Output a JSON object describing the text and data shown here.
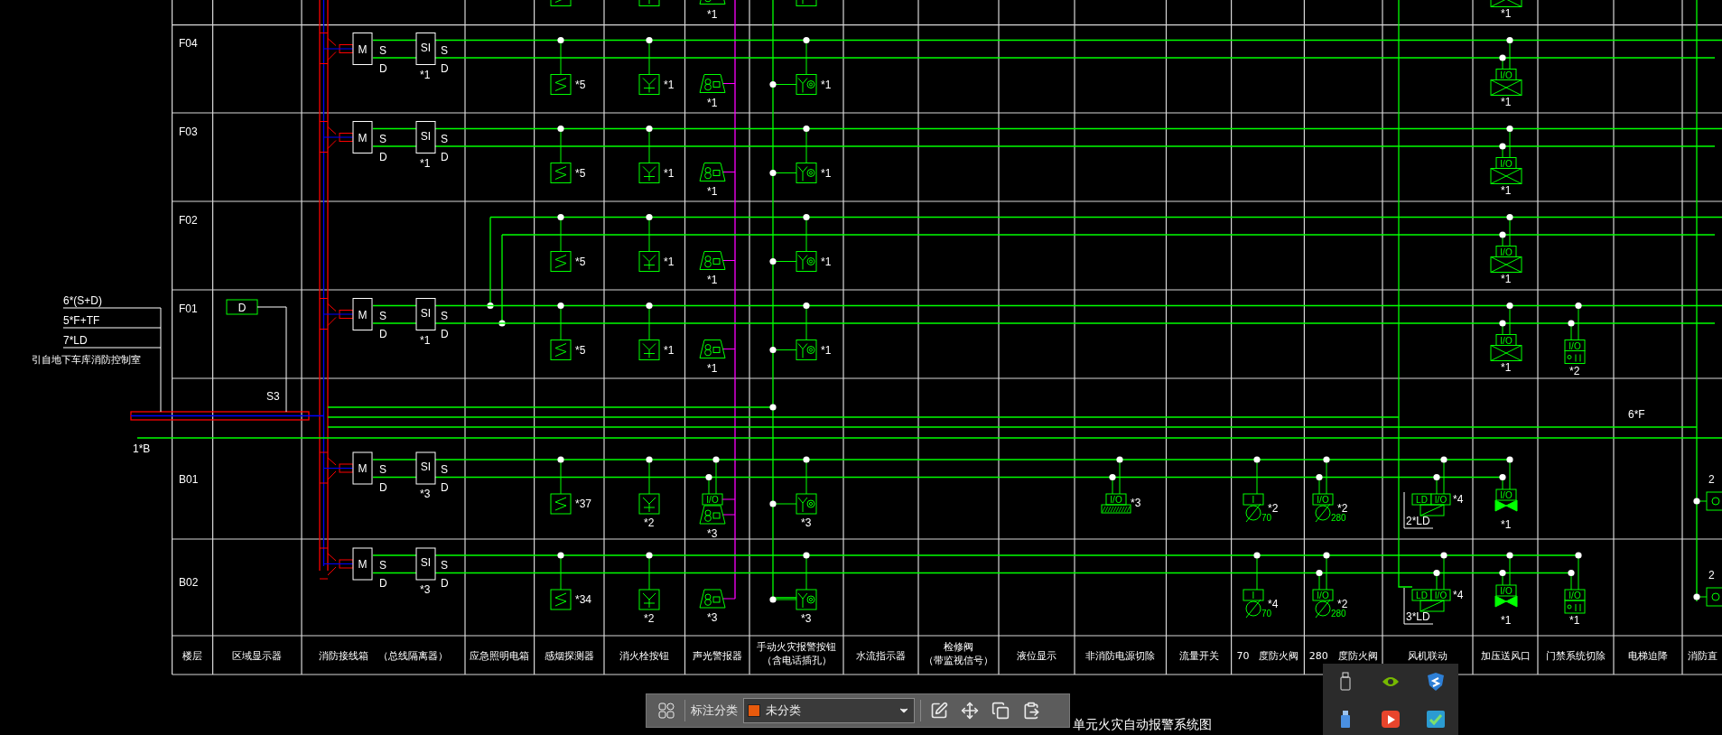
{
  "header": [
    {
      "lines": [
        "楼层"
      ]
    },
    {
      "lines": [
        "区域显示器"
      ]
    },
    {
      "lines": [
        "消防接线箱　（总线隔离器）"
      ]
    },
    {
      "lines": [
        "应急照明电箱"
      ]
    },
    {
      "lines": [
        "感烟探测器"
      ]
    },
    {
      "lines": [
        "消火栓按钮"
      ]
    },
    {
      "lines": [
        "声光警报器"
      ]
    },
    {
      "lines": [
        "手动火灾报警按钮",
        "（含电话插孔）"
      ]
    },
    {
      "lines": [
        "水流指示器"
      ]
    },
    {
      "lines": [
        "检修阀",
        "（带监视信号）"
      ]
    },
    {
      "lines": [
        "液位显示"
      ]
    },
    {
      "lines": [
        "非消防电源切除"
      ]
    },
    {
      "lines": [
        "流量开关"
      ]
    },
    {
      "lines": [
        "70　度防火阀"
      ]
    },
    {
      "lines": [
        "280　度防火阀"
      ]
    },
    {
      "lines": [
        "风机联动"
      ]
    },
    {
      "lines": [
        "加压送风口"
      ]
    },
    {
      "lines": [
        "门禁系统切除"
      ]
    },
    {
      "lines": [
        "电梯迫降"
      ]
    },
    {
      "lines": [
        "消防直"
      ]
    }
  ],
  "feed": {
    "cables": [
      "6*(S+D)",
      "5*F+TF",
      "7*LD"
    ],
    "source": "引自地下车库消防控制室",
    "bus": "1*B"
  },
  "area_display": {
    "symbol": "D",
    "line_label": "S3"
  },
  "fan_bus_label": "6*F",
  "floors": [
    {
      "devices": [
        {
          "kind": "smoke"
        },
        {
          "kind": "hydrant"
        },
        {
          "kind": "alarm",
          "count": "*1"
        },
        {
          "kind": "manual"
        },
        {
          "kind": "vent",
          "count": "*1"
        }
      ]
    },
    {
      "label": "F04",
      "junction": {
        "module": "M",
        "module_in": "S",
        "module_out": "D",
        "isolator": "SI",
        "isolator_in": "S",
        "isolator_out": "D",
        "count": "*1"
      },
      "devices": [
        {
          "kind": "smoke",
          "count": "*5"
        },
        {
          "kind": "hydrant",
          "count": "*1"
        },
        {
          "kind": "alarm",
          "count": "*1"
        },
        {
          "kind": "manual",
          "count": "*1"
        },
        {
          "kind": "vent",
          "io": "I/O",
          "count": "*1"
        }
      ]
    },
    {
      "label": "F03",
      "junction": {
        "module": "M",
        "module_in": "S",
        "module_out": "D",
        "isolator": "SI",
        "isolator_in": "S",
        "isolator_out": "D",
        "count": "*1"
      },
      "devices": [
        {
          "kind": "smoke",
          "count": "*5"
        },
        {
          "kind": "hydrant",
          "count": "*1"
        },
        {
          "kind": "alarm",
          "count": "*1"
        },
        {
          "kind": "manual",
          "count": "*1"
        },
        {
          "kind": "vent",
          "io": "I/O",
          "count": "*1"
        }
      ]
    },
    {
      "label": "F02",
      "devices": [
        {
          "kind": "smoke",
          "count": "*5"
        },
        {
          "kind": "hydrant",
          "count": "*1"
        },
        {
          "kind": "alarm",
          "count": "*1"
        },
        {
          "kind": "manual",
          "count": "*1"
        },
        {
          "kind": "vent",
          "io": "I/O",
          "count": "*1"
        }
      ]
    },
    {
      "label": "F01",
      "junction": {
        "module": "M",
        "module_in": "S",
        "module_out": "D",
        "isolator": "SI",
        "isolator_in": "S",
        "isolator_out": "D",
        "count": "*1"
      },
      "devices": [
        {
          "kind": "smoke",
          "count": "*5"
        },
        {
          "kind": "hydrant",
          "count": "*1"
        },
        {
          "kind": "alarm",
          "count": "*1"
        },
        {
          "kind": "manual",
          "count": "*1"
        },
        {
          "kind": "vent",
          "io": "I/O",
          "count": "*1"
        },
        {
          "kind": "door",
          "io": "I/O",
          "count": "*2"
        }
      ]
    },
    {
      "label": "B01",
      "junction": {
        "module": "M",
        "module_in": "S",
        "module_out": "D",
        "isolator": "SI",
        "isolator_in": "S",
        "isolator_out": "D",
        "count": "*3"
      },
      "devices": [
        {
          "kind": "smoke",
          "count": "*37"
        },
        {
          "kind": "hydrant",
          "count": "*2"
        },
        {
          "kind": "alarm",
          "io": "I/O",
          "count": "*3"
        },
        {
          "kind": "manual",
          "count": "*3"
        },
        {
          "kind": "cutoff",
          "io": "I/O",
          "count": "*3"
        },
        {
          "kind": "damper70",
          "input": "I",
          "size": "70",
          "count": "*2"
        },
        {
          "kind": "damper280",
          "io": "I/O",
          "size": "280",
          "count": "*2"
        },
        {
          "kind": "fan",
          "ld": "LD",
          "io": "I/O",
          "count": "*4",
          "group": "2*LD"
        },
        {
          "kind": "pressure_vent",
          "io": "I/O",
          "count": "*1"
        },
        {
          "kind": "edge",
          "count": "2"
        }
      ]
    },
    {
      "label": "B02",
      "junction": {
        "module": "M",
        "module_in": "S",
        "module_out": "D",
        "isolator": "SI",
        "isolator_in": "S",
        "isolator_out": "D",
        "count": "*3"
      },
      "devices": [
        {
          "kind": "smoke",
          "count": "*34"
        },
        {
          "kind": "hydrant",
          "count": "*2"
        },
        {
          "kind": "alarm",
          "count": "*3"
        },
        {
          "kind": "manual",
          "count": "*3"
        },
        {
          "kind": "damper70",
          "input": "I",
          "size": "70",
          "count": "*4"
        },
        {
          "kind": "damper280",
          "io": "I/O",
          "size": "280",
          "count": "*2"
        },
        {
          "kind": "fan",
          "ld": "LD",
          "io": "I/O",
          "count": "*4",
          "group": "3*LD"
        },
        {
          "kind": "pressure_vent",
          "io": "I/O",
          "count": "*1"
        },
        {
          "kind": "door",
          "io": "I/O",
          "count": "*1"
        },
        {
          "kind": "edge",
          "count": "2"
        }
      ]
    }
  ],
  "toolbar": {
    "label": "标注分类",
    "category": "未分类"
  },
  "drawing_title": "单元火灾自动报警系统图"
}
